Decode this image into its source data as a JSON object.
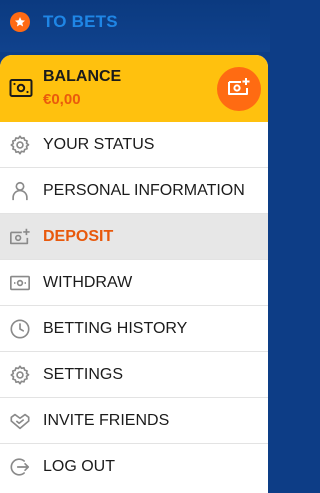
{
  "header": {
    "to_bets_label": "TO BETS",
    "star_icon": "star-icon"
  },
  "balance": {
    "title": "BALANCE",
    "amount": "€0,00",
    "icon": "wallet-money-icon",
    "action_icon": "deposit-money-icon"
  },
  "menu": {
    "items": [
      {
        "label": "YOUR STATUS",
        "icon": "gear-icon",
        "active": false
      },
      {
        "label": "PERSONAL INFORMATION",
        "icon": "person-icon",
        "active": false
      },
      {
        "label": "DEPOSIT",
        "icon": "deposit-icon",
        "active": true
      },
      {
        "label": "WITHDRAW",
        "icon": "withdraw-icon",
        "active": false
      },
      {
        "label": "BETTING HISTORY",
        "icon": "clock-icon",
        "active": false
      },
      {
        "label": "SETTINGS",
        "icon": "gear-icon",
        "active": false
      },
      {
        "label": "INVITE FRIENDS",
        "icon": "handshake-icon",
        "active": false
      },
      {
        "label": "LOG OUT",
        "icon": "logout-icon",
        "active": false
      }
    ]
  },
  "colors": {
    "header_bg": "#0d3d86",
    "header_text": "#1f86e6",
    "accent_orange": "#ff6b12",
    "balance_bg": "#ffc10e",
    "active_text": "#e8590c",
    "active_bg": "#e7e7e7"
  }
}
